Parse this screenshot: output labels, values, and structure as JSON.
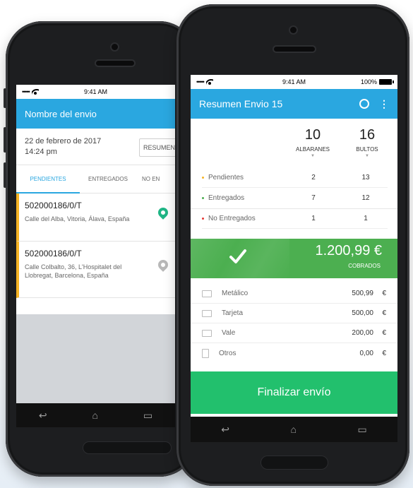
{
  "phone_left": {
    "status": {
      "signal": "•••••",
      "time": "9:41 AM"
    },
    "header": {
      "title": "Nombre del envio"
    },
    "date": {
      "line1": "22 de febrero de 2017",
      "line2": "14:24 pm"
    },
    "resumen_button": "RESUMEN",
    "tabs": [
      "PENDIENTES",
      "ENTREGADOS",
      "NO EN"
    ],
    "shipments": [
      {
        "id": "502000186/0/T",
        "address": "Calle del Alba, Vitoria, Álava, España",
        "pin_color": "#1fb585"
      },
      {
        "id": "502000186/0/T",
        "address": "Calle Colbalto, 36, L'Hospitalet del Llobregat, Barcelona, España",
        "pin_color": "#b8b8b8"
      }
    ],
    "colors": {
      "accent": "#2aa7e0",
      "pending_bar": "#f6b324"
    }
  },
  "phone_right": {
    "status": {
      "signal": "•••••",
      "time": "9:41 AM",
      "battery": "100%"
    },
    "header": {
      "title": "Resumen Envio 15"
    },
    "summary": {
      "albaranes": {
        "value": "10",
        "label": "ALBARANES"
      },
      "bultos": {
        "value": "16",
        "label": "BULTOS"
      },
      "rows": [
        {
          "label": "Pendientes",
          "albaranes": "2",
          "bultos": "13",
          "dot": "#f6b324"
        },
        {
          "label": "Entregados",
          "albaranes": "7",
          "bultos": "12",
          "dot": "#4caf50"
        },
        {
          "label": "No Entregados",
          "albaranes": "1",
          "bultos": "1",
          "dot": "#e53935"
        }
      ]
    },
    "total": {
      "amount": "1.200,99 €",
      "label": "COBRADOS"
    },
    "payments": [
      {
        "label": "Metálico",
        "amount": "500,99",
        "currency": "€"
      },
      {
        "label": "Tarjeta",
        "amount": "500,00",
        "currency": "€"
      },
      {
        "label": "Vale",
        "amount": "200,00",
        "currency": "€"
      },
      {
        "label": "Otros",
        "amount": "0,00",
        "currency": "€"
      }
    ],
    "finalizar_button": "Finalizar envío",
    "colors": {
      "accent": "#2aa7e0",
      "success": "#4caf50",
      "cta": "#22c06d"
    }
  }
}
